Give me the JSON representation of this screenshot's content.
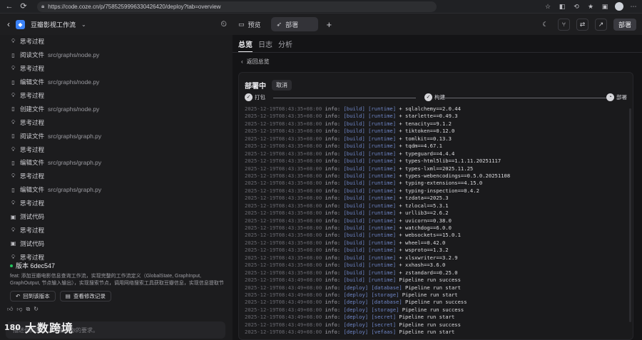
{
  "browser": {
    "url": "https://code.coze.cn/p/7585259996330426420/deploy?tab=overview"
  },
  "header": {
    "project_name": "豆瓣影视工作流",
    "tabs": [
      {
        "label": "预览"
      },
      {
        "label": "部署"
      }
    ],
    "deploy_button": "部署"
  },
  "steps": [
    {
      "icon": "thinking-icon",
      "label": "思考过程",
      "path": ""
    },
    {
      "icon": "file-icon",
      "label": "阅读文件",
      "path": "src/graphs/node.py"
    },
    {
      "icon": "thinking-icon",
      "label": "思考过程",
      "path": ""
    },
    {
      "icon": "file-icon",
      "label": "编辑文件",
      "path": "src/graphs/node.py"
    },
    {
      "icon": "thinking-icon",
      "label": "思考过程",
      "path": ""
    },
    {
      "icon": "file-icon",
      "label": "创建文件",
      "path": "src/graphs/node.py"
    },
    {
      "icon": "thinking-icon",
      "label": "思考过程",
      "path": ""
    },
    {
      "icon": "file-icon",
      "label": "阅读文件",
      "path": "src/graphs/graph.py"
    },
    {
      "icon": "thinking-icon",
      "label": "思考过程",
      "path": ""
    },
    {
      "icon": "file-icon",
      "label": "编辑文件",
      "path": "src/graphs/graph.py"
    },
    {
      "icon": "thinking-icon",
      "label": "思考过程",
      "path": ""
    },
    {
      "icon": "file-icon",
      "label": "编辑文件",
      "path": "src/graphs/graph.py"
    },
    {
      "icon": "thinking-icon",
      "label": "思考过程",
      "path": ""
    },
    {
      "icon": "code-icon",
      "label": "测试代码",
      "path": ""
    },
    {
      "icon": "thinking-icon",
      "label": "思考过程",
      "path": ""
    },
    {
      "icon": "code-icon",
      "label": "测试代码",
      "path": ""
    },
    {
      "icon": "thinking-icon",
      "label": "思考过程",
      "path": ""
    }
  ],
  "version": {
    "title": "版本 6dec547",
    "description": "feat: 添加豆瓣电影信息查询工作流，实现完整的工作流定义（GlobalState, GraphInput, GraphOutput, 节点输入输出），实现搜索节点，调用网络搜索工具获取豆瓣信息，实现信息提取节点，调用大语言模型...",
    "rollback_label": "回到该版本",
    "view_changes_label": "查看修改记录"
  },
  "input": {
    "placeholder": "描述你的需求，或输入你的要求。"
  },
  "watermark": {
    "logo": "180",
    "text": "大数跨境"
  },
  "right": {
    "tabs": [
      {
        "label": "总览"
      },
      {
        "label": "日志"
      },
      {
        "label": "分析"
      }
    ],
    "back_label": "返回总览",
    "status_title": "部署中",
    "cancel_label": "取消",
    "progress": [
      {
        "label": "打包"
      },
      {
        "label": "构建"
      },
      {
        "label": "部署"
      }
    ]
  },
  "logs": [
    {
      "t": "2025-12-19T08:43:35+08:00",
      "l": "info:",
      "tags": "[build] [runtime]",
      "m": "+ sqlalchemy==2.0.44"
    },
    {
      "t": "2025-12-19T08:43:35+08:00",
      "l": "info:",
      "tags": "[build] [runtime]",
      "m": "+ starlette==0.49.3"
    },
    {
      "t": "2025-12-19T08:43:35+08:00",
      "l": "info:",
      "tags": "[build] [runtime]",
      "m": "+ tenacity==9.1.2"
    },
    {
      "t": "2025-12-19T08:43:35+08:00",
      "l": "info:",
      "tags": "[build] [runtime]",
      "m": "+ tiktoken==0.12.0"
    },
    {
      "t": "2025-12-19T08:43:35+08:00",
      "l": "info:",
      "tags": "[build] [runtime]",
      "m": "+ tomlkit==0.13.3"
    },
    {
      "t": "2025-12-19T08:43:35+08:00",
      "l": "info:",
      "tags": "[build] [runtime]",
      "m": "+ tqdm==4.67.1"
    },
    {
      "t": "2025-12-19T08:43:35+08:00",
      "l": "info:",
      "tags": "[build] [runtime]",
      "m": "+ typeguard==4.4.4"
    },
    {
      "t": "2025-12-19T08:43:35+08:00",
      "l": "info:",
      "tags": "[build] [runtime]",
      "m": "+ types-html5lib==1.1.11.20251117"
    },
    {
      "t": "2025-12-19T08:43:35+08:00",
      "l": "info:",
      "tags": "[build] [runtime]",
      "m": "+ types-lxml==2025.11.25"
    },
    {
      "t": "2025-12-19T08:43:35+08:00",
      "l": "info:",
      "tags": "[build] [runtime]",
      "m": "+ types-webencodings==0.5.0.20251108"
    },
    {
      "t": "2025-12-19T08:43:35+08:00",
      "l": "info:",
      "tags": "[build] [runtime]",
      "m": "+ typing-extensions==4.15.0"
    },
    {
      "t": "2025-12-19T08:43:35+08:00",
      "l": "info:",
      "tags": "[build] [runtime]",
      "m": "+ typing-inspection==0.4.2"
    },
    {
      "t": "2025-12-19T08:43:35+08:00",
      "l": "info:",
      "tags": "[build] [runtime]",
      "m": "+ tzdata==2025.3"
    },
    {
      "t": "2025-12-19T08:43:35+08:00",
      "l": "info:",
      "tags": "[build] [runtime]",
      "m": "+ tzlocal==5.3.1"
    },
    {
      "t": "2025-12-19T08:43:35+08:00",
      "l": "info:",
      "tags": "[build] [runtime]",
      "m": "+ urllib3==2.6.2"
    },
    {
      "t": "2025-12-19T08:43:35+08:00",
      "l": "info:",
      "tags": "[build] [runtime]",
      "m": "+ uvicorn==0.38.0"
    },
    {
      "t": "2025-12-19T08:43:35+08:00",
      "l": "info:",
      "tags": "[build] [runtime]",
      "m": "+ watchdog==6.0.0"
    },
    {
      "t": "2025-12-19T08:43:35+08:00",
      "l": "info:",
      "tags": "[build] [runtime]",
      "m": "+ websockets==15.0.1"
    },
    {
      "t": "2025-12-19T08:43:35+08:00",
      "l": "info:",
      "tags": "[build] [runtime]",
      "m": "+ wheel==0.42.0"
    },
    {
      "t": "2025-12-19T08:43:35+08:00",
      "l": "info:",
      "tags": "[build] [runtime]",
      "m": "+ wsproto==1.3.2"
    },
    {
      "t": "2025-12-19T08:43:35+08:00",
      "l": "info:",
      "tags": "[build] [runtime]",
      "m": "+ xlsxwriter==3.2.9"
    },
    {
      "t": "2025-12-19T08:43:35+08:00",
      "l": "info:",
      "tags": "[build] [runtime]",
      "m": "+ xxhash==3.6.0"
    },
    {
      "t": "2025-12-19T08:43:35+08:00",
      "l": "info:",
      "tags": "[build] [runtime]",
      "m": "+ zstandard==0.25.0"
    },
    {
      "t": "2025-12-19T08:43:49+08:00",
      "l": "info:",
      "tags": "[build] [runtime]",
      "m": "Pipeline run success"
    },
    {
      "t": "2025-12-19T08:43:49+08:00",
      "l": "info:",
      "tags": "[deploy] [database]",
      "m": "Pipeline run start"
    },
    {
      "t": "2025-12-19T08:43:49+08:00",
      "l": "info:",
      "tags": "[deploy] [storage]",
      "m": "Pipeline run start"
    },
    {
      "t": "2025-12-19T08:43:49+08:00",
      "l": "info:",
      "tags": "[deploy] [database]",
      "m": "Pipeline run success"
    },
    {
      "t": "2025-12-19T08:43:49+08:00",
      "l": "info:",
      "tags": "[deploy] [storage]",
      "m": "Pipeline run success"
    },
    {
      "t": "2025-12-19T08:43:49+08:00",
      "l": "info:",
      "tags": "[deploy] [secret]",
      "m": "Pipeline run start"
    },
    {
      "t": "2025-12-19T08:43:49+08:00",
      "l": "info:",
      "tags": "[deploy] [secret]",
      "m": "Pipeline run success"
    },
    {
      "t": "2025-12-19T08:43:49+08:00",
      "l": "info:",
      "tags": "[deploy] [vefaas]",
      "m": "Pipeline run start"
    }
  ]
}
